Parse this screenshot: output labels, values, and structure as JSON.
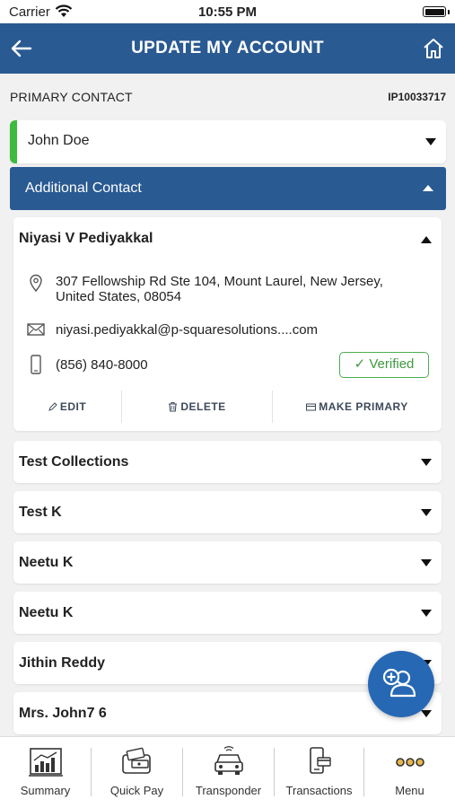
{
  "status_bar": {
    "carrier": "Carrier",
    "time": "10:55 PM"
  },
  "header": {
    "title": "UPDATE MY ACCOUNT"
  },
  "primary": {
    "section_label": "PRIMARY CONTACT",
    "account_id": "IP10033717",
    "name": "John  Doe",
    "accent_color": "#3dbb3d"
  },
  "additional": {
    "label": "Additional Contact",
    "expanded_contact": {
      "name": "Niyasi V Pediyakkal",
      "address_line1": "307 Fellowship Rd Ste 104, Mount Laurel, New Jersey,",
      "address_line2": "United States, 08054",
      "email": "niyasi.pediyakkal@p-squaresolutions....com",
      "phone": "(856) 840-8000",
      "verified_label": "Verified",
      "actions": {
        "edit": "EDIT",
        "delete": "DELETE",
        "make_primary": "MAKE PRIMARY"
      }
    },
    "contacts": [
      {
        "name": "Test Collections"
      },
      {
        "name": "Test K"
      },
      {
        "name": "Neetu K"
      },
      {
        "name": "Neetu K"
      },
      {
        "name": "Jithin  Reddy"
      },
      {
        "name": "Mrs. John7  6"
      }
    ]
  },
  "tabs": [
    {
      "label": "Summary",
      "icon": "summary-chart-icon"
    },
    {
      "label": "Quick Pay",
      "icon": "wallet-icon"
    },
    {
      "label": "Transponder",
      "icon": "car-icon"
    },
    {
      "label": "Transactions",
      "icon": "phone-card-icon"
    },
    {
      "label": "Menu",
      "icon": "dots-icon"
    }
  ],
  "colors": {
    "brand": "#2a5a92",
    "fab": "#2668b4",
    "verified": "#4caf50"
  }
}
